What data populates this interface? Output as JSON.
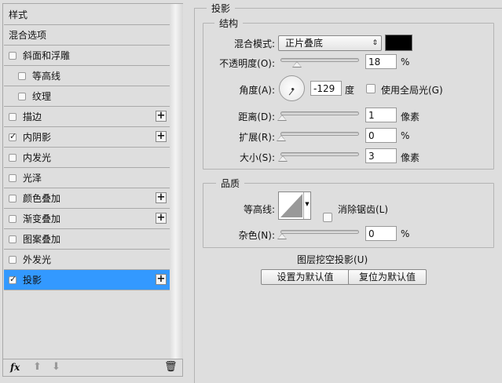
{
  "sidebar": {
    "items": [
      {
        "label": "样式",
        "checkbox": null,
        "plus": false,
        "indent": false
      },
      {
        "label": "混合选项",
        "checkbox": null,
        "plus": false,
        "indent": false
      },
      {
        "label": "斜面和浮雕",
        "checkbox": false,
        "plus": false,
        "indent": false
      },
      {
        "label": "等高线",
        "checkbox": false,
        "plus": false,
        "indent": true
      },
      {
        "label": "纹理",
        "checkbox": false,
        "plus": false,
        "indent": true
      },
      {
        "label": "描边",
        "checkbox": false,
        "plus": true,
        "indent": false
      },
      {
        "label": "内阴影",
        "checkbox": true,
        "plus": true,
        "indent": false
      },
      {
        "label": "内发光",
        "checkbox": false,
        "plus": false,
        "indent": false
      },
      {
        "label": "光泽",
        "checkbox": false,
        "plus": false,
        "indent": false
      },
      {
        "label": "颜色叠加",
        "checkbox": false,
        "plus": true,
        "indent": false
      },
      {
        "label": "渐变叠加",
        "checkbox": false,
        "plus": true,
        "indent": false
      },
      {
        "label": "图案叠加",
        "checkbox": false,
        "plus": false,
        "indent": false
      },
      {
        "label": "外发光",
        "checkbox": false,
        "plus": false,
        "indent": false
      },
      {
        "label": "投影",
        "checkbox": true,
        "plus": true,
        "indent": false,
        "selected": true
      }
    ],
    "fx_label": "fx"
  },
  "panel": {
    "title": "投影",
    "structure": {
      "title": "结构",
      "blend_mode_label": "混合模式:",
      "blend_mode": "正片叠底",
      "shadow_color": "#000000",
      "opacity_label": "不透明度(O):",
      "opacity": "18",
      "opacity_unit": "%",
      "angle_label": "角度(A):",
      "angle": "-129",
      "angle_unit": "度",
      "global_light_label": "使用全局光(G)",
      "global_light": false,
      "distance_label": "距离(D):",
      "distance": "1",
      "distance_unit": "像素",
      "spread_label": "扩展(R):",
      "spread": "0",
      "spread_unit": "%",
      "size_label": "大小(S):",
      "size": "3",
      "size_unit": "像素"
    },
    "quality": {
      "title": "品质",
      "contour_label": "等高线:",
      "antialias_label": "消除锯齿(L)",
      "antialias": false,
      "noise_label": "杂色(N):",
      "noise": "0",
      "noise_unit": "%"
    },
    "knockout_label": "图层挖空投影(U)",
    "knockout": true,
    "set_default_label": "设置为默认值",
    "reset_default_label": "复位为默认值"
  }
}
